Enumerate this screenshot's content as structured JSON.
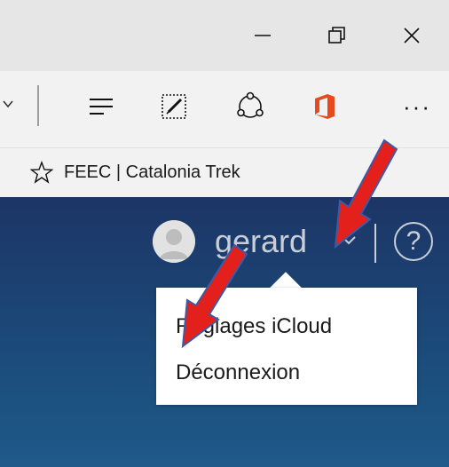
{
  "window_controls": {
    "minimize_icon": "minimize-icon",
    "restore_icon": "restore-icon",
    "close_icon": "close-icon"
  },
  "toolbar": {
    "buttons": [
      "hub-icon",
      "web-note-icon",
      "share-icon",
      "office-icon",
      "more-icon"
    ],
    "more_label": "···"
  },
  "favorites": {
    "items": [
      {
        "label": "FEEC | Catalonia Trek"
      }
    ]
  },
  "account": {
    "username": "gerard",
    "help_label": "?"
  },
  "dropdown": {
    "items": [
      {
        "label": "Réglages iCloud"
      },
      {
        "label": "Déconnexion"
      }
    ]
  },
  "colors": {
    "page_top": "#1c3566",
    "page_bottom": "#1e5a8a",
    "office_orange": "#e74a1d",
    "annotation_arrow": "#e3201b",
    "annotation_outline": "#3d5aa5"
  }
}
